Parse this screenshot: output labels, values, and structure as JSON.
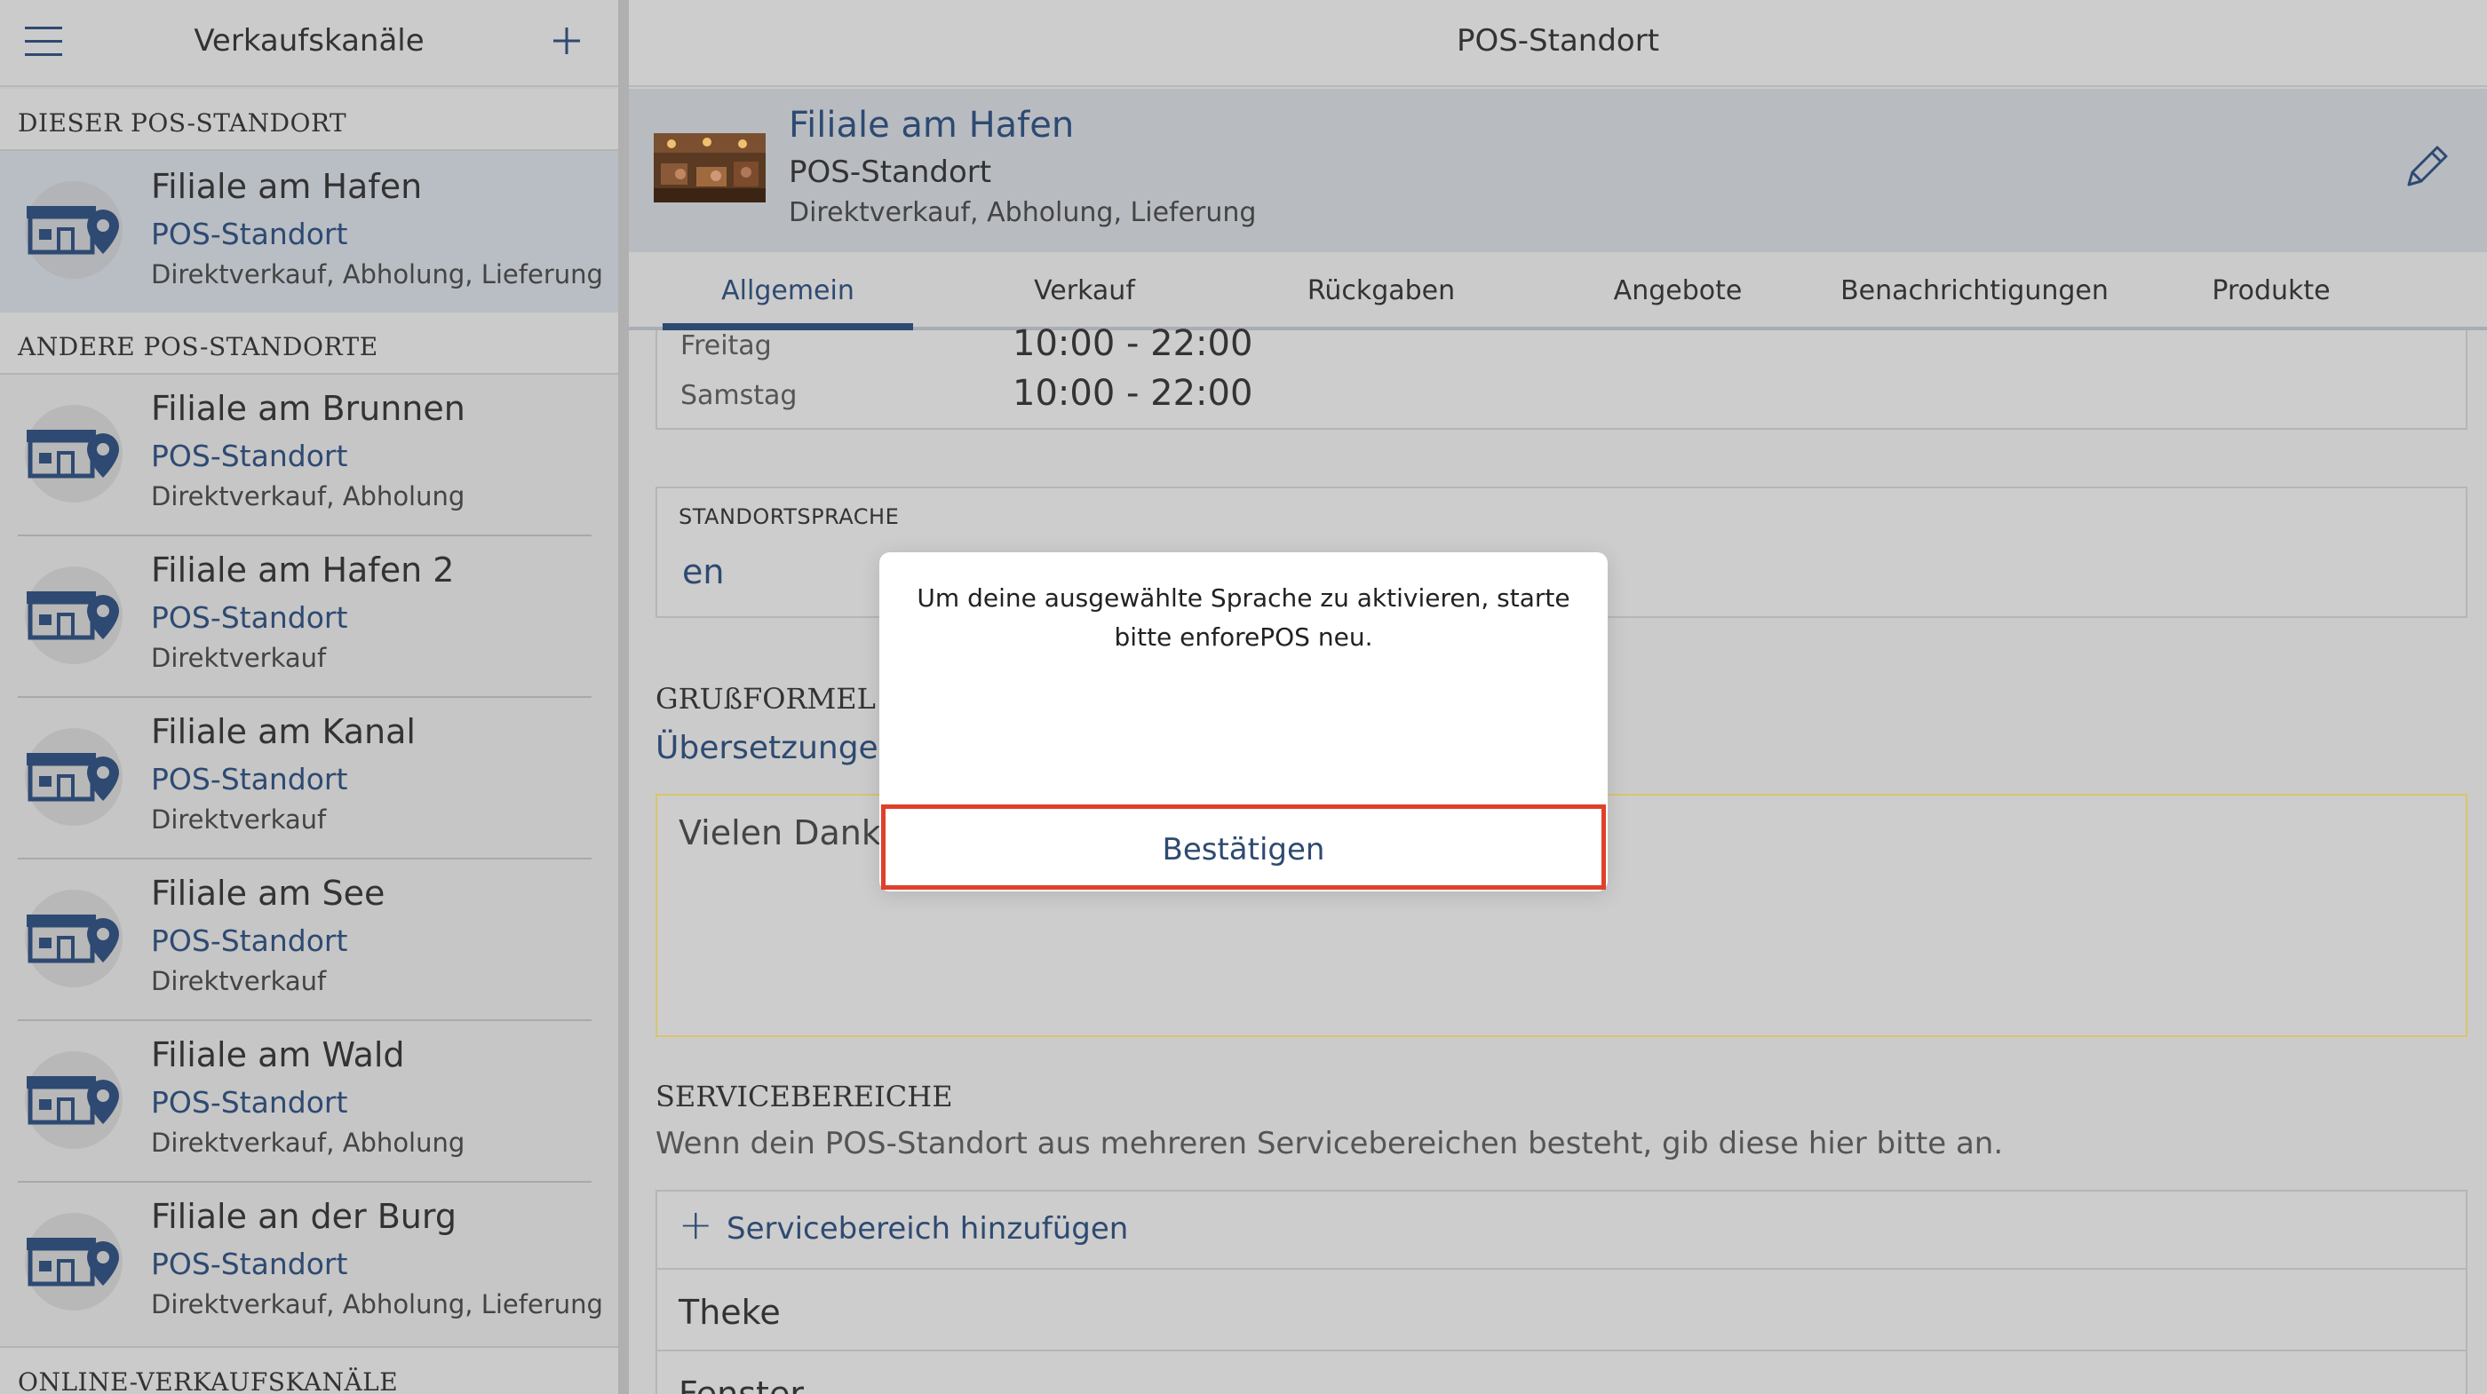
{
  "sidebar": {
    "title": "Verkaufskanäle",
    "sections": {
      "this": "DIESER POS-STANDORT",
      "others": "ANDERE POS-STANDORTE",
      "online": "ONLINE-VERKAUFSKANÄLE"
    },
    "current": {
      "name": "Filiale am Hafen",
      "type": "POS-Standort",
      "desc": "Direktverkauf, Abholung, Lieferung"
    },
    "others": [
      {
        "name": "Filiale am Brunnen",
        "type": "POS-Standort",
        "desc": "Direktverkauf, Abholung"
      },
      {
        "name": "Filiale am Hafen 2",
        "type": "POS-Standort",
        "desc": "Direktverkauf"
      },
      {
        "name": "Filiale am Kanal",
        "type": "POS-Standort",
        "desc": "Direktverkauf"
      },
      {
        "name": "Filiale am See",
        "type": "POS-Standort",
        "desc": "Direktverkauf"
      },
      {
        "name": "Filiale am Wald",
        "type": "POS-Standort",
        "desc": "Direktverkauf, Abholung"
      },
      {
        "name": "Filiale an der Burg",
        "type": "POS-Standort",
        "desc": "Direktverkauf, Abholung, Lieferung"
      }
    ]
  },
  "main": {
    "title": "POS-Standort",
    "location": {
      "name": "Filiale am Hafen",
      "type": "POS-Standort",
      "desc": "Direktverkauf, Abholung, Lieferung"
    },
    "tabs": [
      "Allgemein",
      "Verkauf",
      "Rückgaben",
      "Angebote",
      "Benachrichtigungen",
      "Produkte"
    ],
    "active_tab": "Allgemein",
    "hours": [
      {
        "day": "Freitag",
        "time": "10:00 - 22:00"
      },
      {
        "day": "Samstag",
        "time": "10:00 - 22:00"
      }
    ],
    "language": {
      "label": "STANDORTSPRACHE",
      "value": "en"
    },
    "greeting": {
      "heading": "GRUßFORMEL",
      "translations": "Übersetzungen",
      "text": "Vielen Dank &"
    },
    "service": {
      "heading": "SERVICEBEREICHE",
      "desc": "Wenn dein POS-Standort aus mehreren Servicebereichen besteht, gib diese hier bitte an.",
      "add_label": "Servicebereich hinzufügen",
      "add_symbol": "+",
      "areas": [
        "Theke",
        "Fenster"
      ]
    }
  },
  "dialog": {
    "message": "Um deine ausgewählte Sprache zu aktivieren, starte bitte enforePOS neu.",
    "confirm": "Bestätigen"
  },
  "colors": {
    "accent": "#2e4a72",
    "highlight": "#e0402b",
    "selected_bg": "#b9bec4"
  },
  "icons": {
    "menu": "hamburger-menu-icon",
    "add": "plus-icon",
    "edit": "pencil-icon",
    "store": "store-location-icon"
  }
}
